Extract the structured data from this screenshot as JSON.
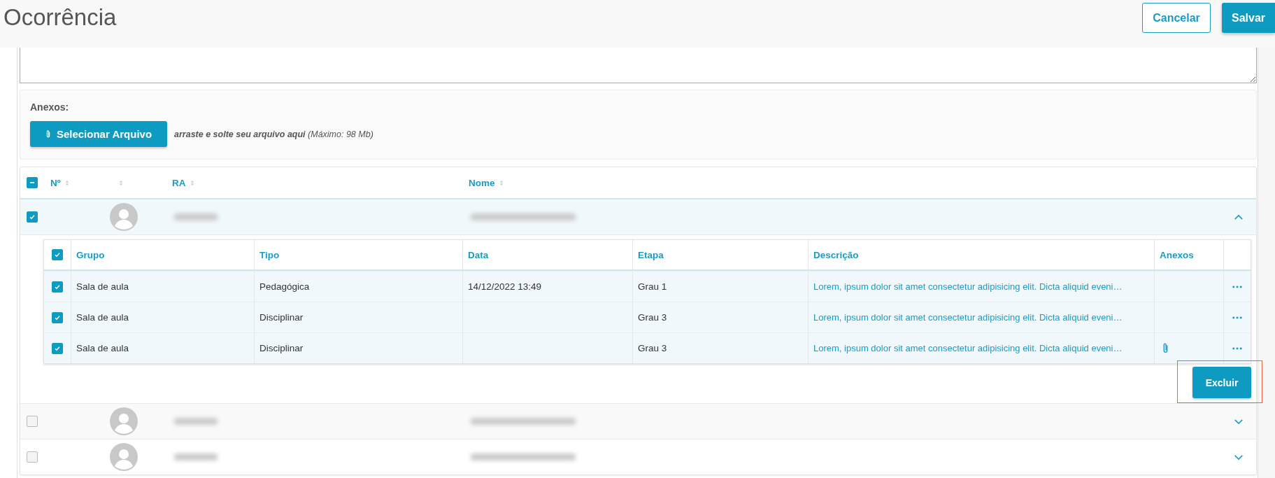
{
  "header": {
    "title": "Ocorrência",
    "buttons": [
      {
        "label": "Cancelar",
        "kind": "secondary"
      },
      {
        "label": "Salvar",
        "kind": "primary"
      }
    ]
  },
  "attachments": {
    "label": "Anexos:",
    "button": "Selecionar Arquivo",
    "hint": "**arraste e solte seu arquivo aqui** (Máximo: 98 Mb)"
  },
  "students": {
    "select_all_partial": true,
    "columns": [
      {
        "label": "Nº",
        "sortable": true
      },
      {
        "sortable": true
      },
      {
        "label": "RA",
        "sortable": true
      },
      {
        "label": "Nome",
        "sortable": true
      }
    ],
    "rows": [
      {
        "selected": true,
        "expanded": true
      },
      {
        "selected": false,
        "expanded": false
      },
      {
        "selected": false,
        "expanded": false
      }
    ]
  },
  "occurrences": {
    "all_checked": true,
    "columns": [
      "Grupo",
      "Tipo",
      "Data",
      "Etapa",
      "Descrição",
      "Anexos"
    ],
    "rows": [
      {
        "checked": true,
        "grupo": "Sala de aula",
        "tipo": "Pedagógica",
        "data": "14/12/2022 13:49",
        "etapa": "Grau 1",
        "descricao": "Lorem, ipsum dolor sit amet consectetur adipisicing elit. Dicta aliquid eveni…",
        "has_attachment": false
      },
      {
        "checked": true,
        "grupo": "Sala de aula",
        "tipo": "Disciplinar",
        "etapa": "Grau 3",
        "descricao": "Lorem, ipsum dolor sit amet consectetur adipisicing elit. Dicta aliquid eveni…",
        "has_attachment": false
      },
      {
        "checked": true,
        "grupo": "Sala de aula",
        "tipo": "Disciplinar",
        "etapa": "Grau 3",
        "descricao": "Lorem, ipsum dolor sit amet consectetur adipisicing elit. Dicta aliquid eveni…",
        "has_attachment": true
      }
    ],
    "delete_button": "Excluir",
    "highlighted": true
  }
}
